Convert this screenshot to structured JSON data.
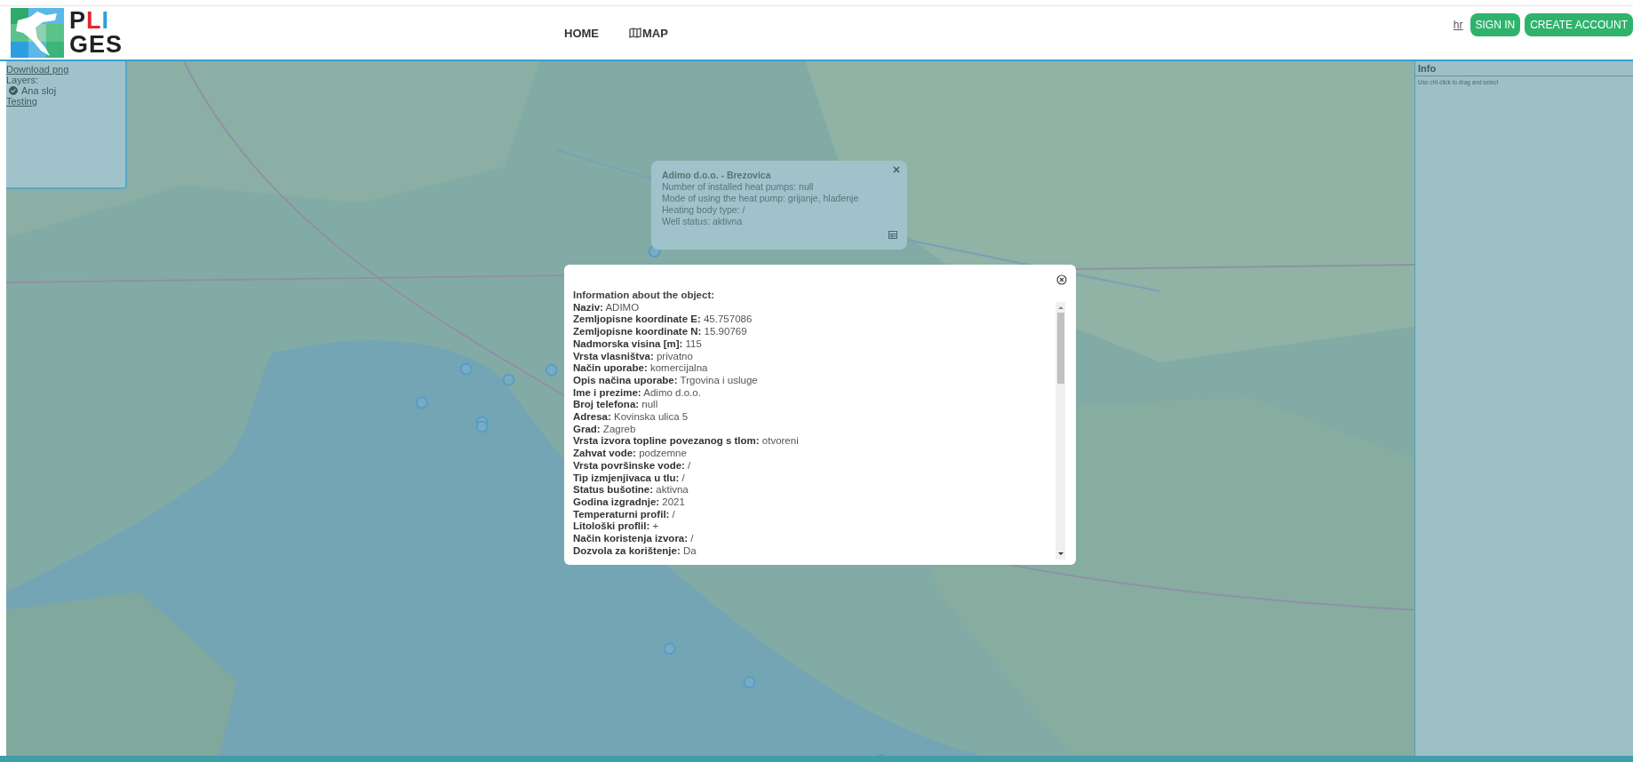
{
  "logo": {
    "line_1": [
      {
        "text": "P",
        "color": "#222222"
      },
      {
        "text": "L",
        "color": "#e5262a"
      },
      {
        "text": "I",
        "color": "#2b9fe0"
      }
    ],
    "line_2": "GES"
  },
  "nav": [
    {
      "label": "HOME",
      "kind": "text"
    },
    {
      "label": "MAP",
      "kind": "map"
    }
  ],
  "header_actions": {
    "language": "hr",
    "buttons": [
      "SIGN IN",
      "CREATE ACCOUNT"
    ]
  },
  "layers_panel": {
    "download": "Download png",
    "layers_title": "Layers:",
    "layers": [
      {
        "label": "Ana sloj",
        "checked": true
      }
    ],
    "link": "Testing"
  },
  "info_panel": {
    "title": "Info",
    "hint": "Use ctrl-click to drag and select"
  },
  "map_popup": {
    "title": "Adimo d.o.o. - Brezovica",
    "lines": [
      "Number of installed heat pumps: null",
      "Mode of using the heat pump: grijanje, hlađenje",
      "Heating body type: /",
      "Well status: aktivna"
    ]
  },
  "modal": {
    "title": "Information about the object:",
    "fields": [
      {
        "label": "Naziv:",
        "value": "ADIMO"
      },
      {
        "label": "Zemljopisne koordinate E:",
        "value": "45.757086"
      },
      {
        "label": "Zemljopisne koordinate N:",
        "value": "15.90769"
      },
      {
        "label": "Nadmorska visina [m]:",
        "value": "115"
      },
      {
        "label": "Vrsta vlasništva:",
        "value": "privatno"
      },
      {
        "label": "Način uporabe:",
        "value": "komercijalna"
      },
      {
        "label": "Opis načina uporabe:",
        "value": "Trgovina i usluge"
      },
      {
        "label": "Ime i prezime:",
        "value": "Adimo d.o.o."
      },
      {
        "label": "Broj telefona:",
        "value": "null"
      },
      {
        "label": "Adresa:",
        "value": "Kovinska ulica 5"
      },
      {
        "label": "Grad:",
        "value": "Zagreb"
      },
      {
        "label": "Vrsta izvora topline povezanog s tlom:",
        "value": "otvoreni"
      },
      {
        "label": "Zahvat vode:",
        "value": "podzemne"
      },
      {
        "label": "Vrsta površinske vode:",
        "value": "/"
      },
      {
        "label": "Tip izmjenjivaca u tlu:",
        "value": "/"
      },
      {
        "label": "Status bušotine:",
        "value": "aktivna"
      },
      {
        "label": "Godina izgradnje:",
        "value": "2021"
      },
      {
        "label": "Temperaturni profil:",
        "value": "/"
      },
      {
        "label": "Litološki proflil:",
        "value": "+"
      },
      {
        "label": "Način koristenja izvora:",
        "value": "/"
      },
      {
        "label": "Dozvola za korištenje:",
        "value": "Da"
      }
    ]
  }
}
